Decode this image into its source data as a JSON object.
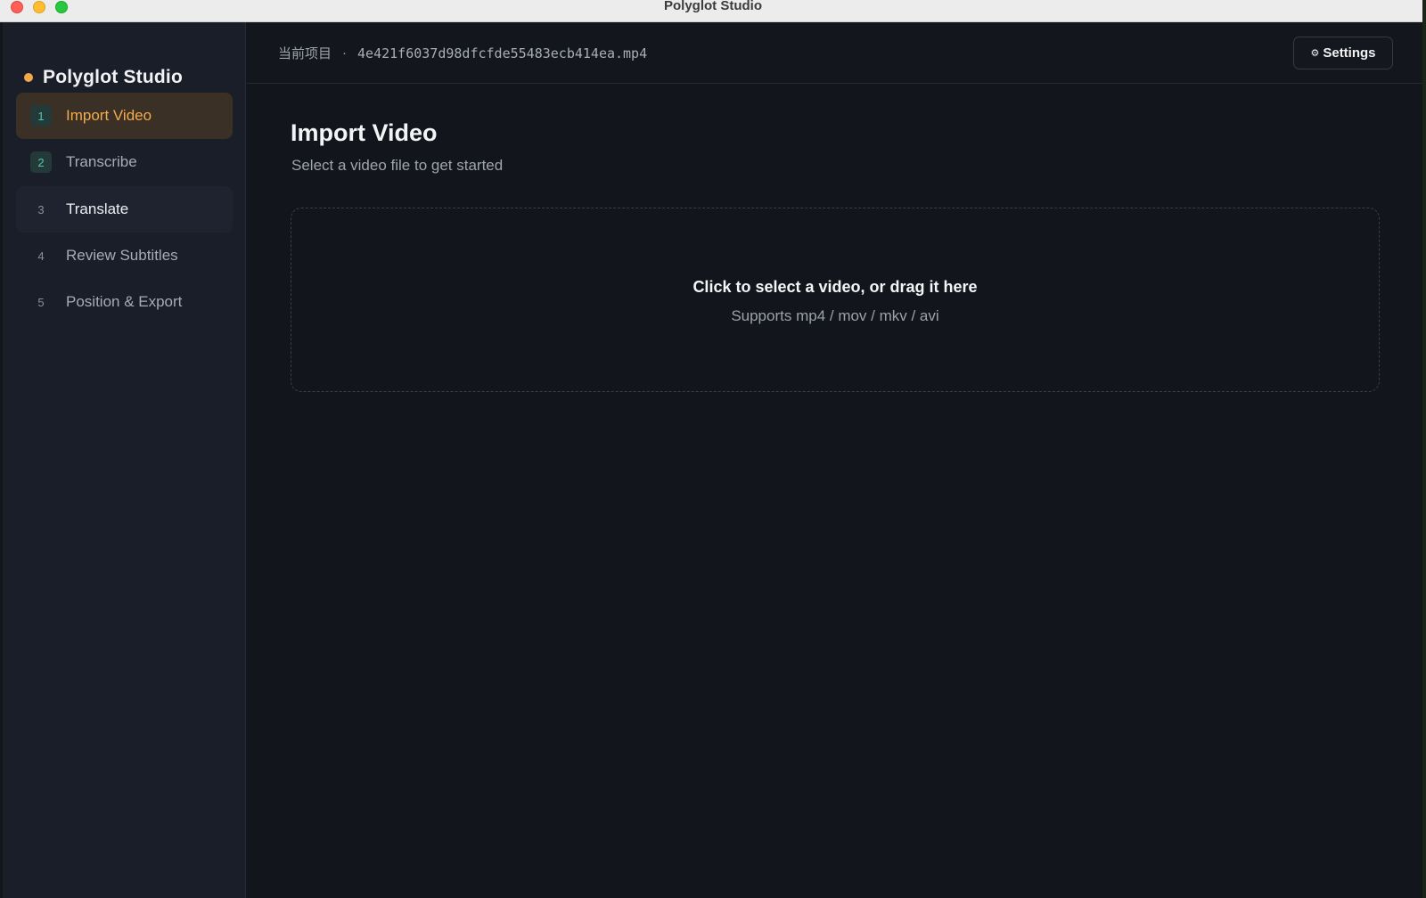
{
  "window": {
    "title": "Polyglot Studio"
  },
  "sidebar": {
    "brand": "Polyglot Studio",
    "steps": [
      {
        "num": "1",
        "label": "Import Video"
      },
      {
        "num": "2",
        "label": "Transcribe"
      },
      {
        "num": "3",
        "label": "Translate"
      },
      {
        "num": "4",
        "label": "Review Subtitles"
      },
      {
        "num": "5",
        "label": "Position & Export"
      }
    ]
  },
  "topbar": {
    "project_label": "当前项目",
    "separator": "·",
    "file_name": "4e421f6037d98dfcfde55483ecb414ea.mp4",
    "settings_label": "Settings",
    "settings_icon": "⚙"
  },
  "main": {
    "title": "Import Video",
    "subtitle": "Select a video file to get started",
    "dropzone": {
      "title": "Click to select a video, or drag it here",
      "subtitle": "Supports mp4 / mov / mkv / avi"
    }
  },
  "colors": {
    "accent": "#f4aa4c",
    "teal": "#4fc7b0",
    "background": "#12151b",
    "sidebar": "#1a1e29"
  }
}
